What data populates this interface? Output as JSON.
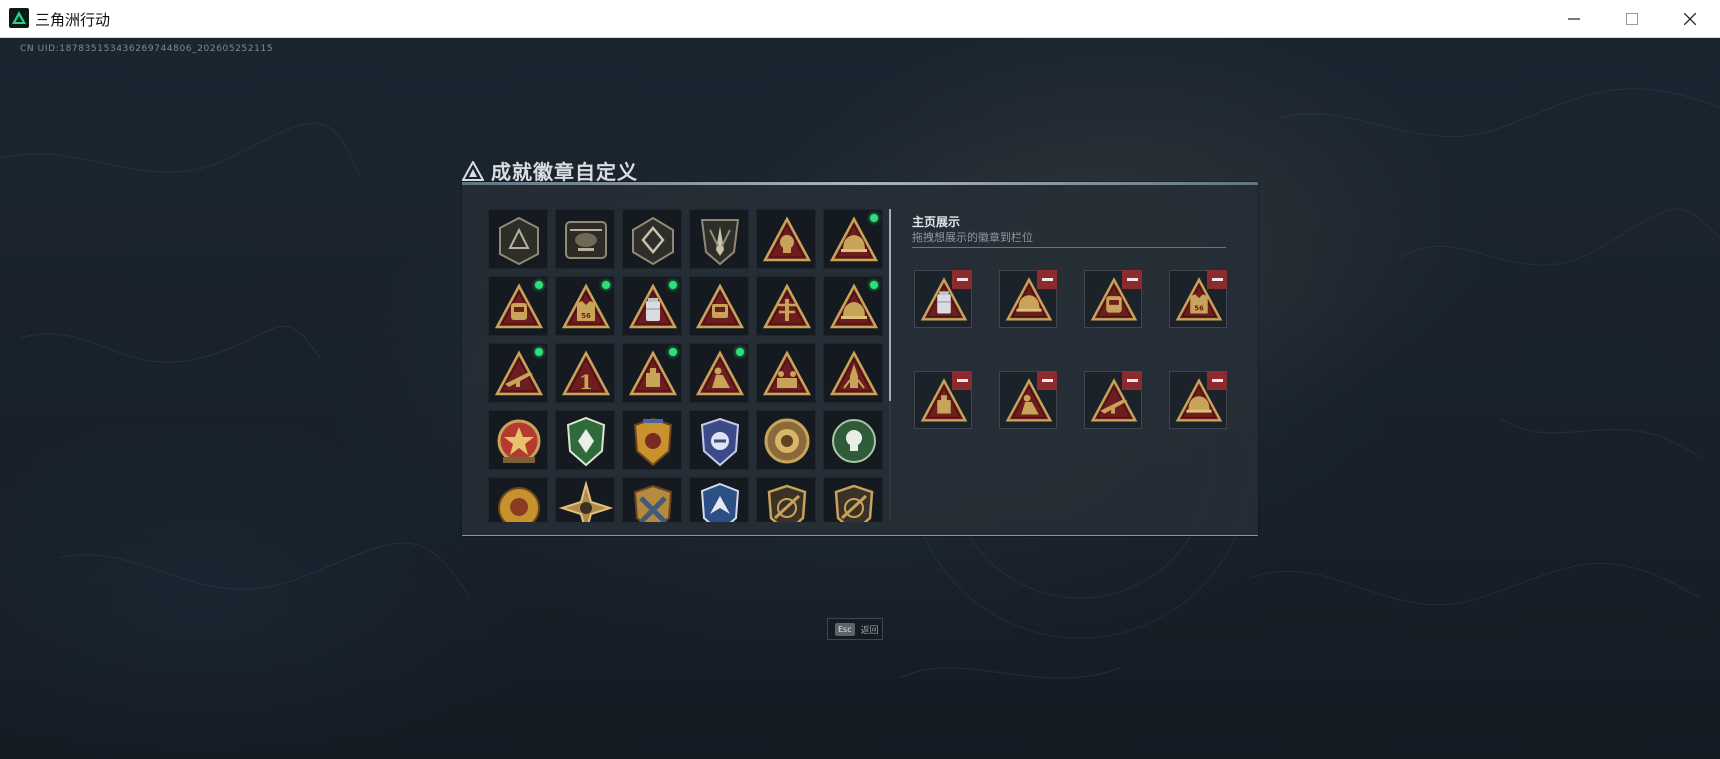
{
  "window": {
    "title": "三角洲行动",
    "icons": {
      "app": "delta-logo-icon",
      "minimize": "minimize-icon",
      "maximize": "maximize-icon",
      "close": "close-icon"
    }
  },
  "overlay": {
    "uid": "CN UID:187835153436269744806_202605252115"
  },
  "panel": {
    "title": "成就徽章自定义",
    "title_icon": "delta-triangle-icon"
  },
  "colors": {
    "gold": "#c8a35a",
    "dark_red": "#6e1d1f",
    "new_dot": "#2ee07a",
    "remove": "#8c2a2e"
  },
  "badge_grid": {
    "rows": [
      [
        {
          "icon": "delta-emblem-badge",
          "new": false
        },
        {
          "icon": "helicopter-badge",
          "new": false
        },
        {
          "icon": "diamond-crest-badge",
          "new": false
        },
        {
          "icon": "blade-crest-badge",
          "new": false
        },
        {
          "icon": "skull-triangle-badge",
          "new": false
        },
        {
          "icon": "helmet-triangle-badge",
          "new": true
        }
      ],
      [
        {
          "icon": "backpack-triangle-badge",
          "new": true
        },
        {
          "icon": "vest-56-triangle-badge",
          "new": true
        },
        {
          "icon": "silver-jar-triangle-badge",
          "new": true
        },
        {
          "icon": "device-triangle-badge",
          "new": false
        },
        {
          "icon": "radio-tower-triangle-badge",
          "new": false
        },
        {
          "icon": "helmet-triangle-badge",
          "new": true
        }
      ],
      [
        {
          "icon": "rifle-triangle-badge",
          "new": true
        },
        {
          "icon": "number-one-triangle-badge",
          "new": false
        },
        {
          "icon": "crate-triangle-badge",
          "new": true
        },
        {
          "icon": "soldier-triangle-badge",
          "new": true
        },
        {
          "icon": "squad-triangle-badge",
          "new": false
        },
        {
          "icon": "rocket-triangle-badge",
          "new": false
        }
      ],
      [
        {
          "icon": "red-star-medal-badge",
          "new": false
        },
        {
          "icon": "green-shield-badge",
          "new": false
        },
        {
          "icon": "gold-shield-badge",
          "new": false
        },
        {
          "icon": "blue-shield-badge",
          "new": false
        },
        {
          "icon": "gold-disc-badge",
          "new": false
        },
        {
          "icon": "green-skull-badge",
          "new": false
        }
      ],
      [
        {
          "icon": "gold-lion-badge",
          "new": false
        },
        {
          "icon": "gold-star-burst-badge",
          "new": false
        },
        {
          "icon": "gold-crossed-badge",
          "new": false
        },
        {
          "icon": "blue-wolf-badge",
          "new": false
        },
        {
          "icon": "gold-slash-shield-badge",
          "new": false
        },
        {
          "icon": "gold-slash-shield-badge",
          "new": false
        }
      ]
    ]
  },
  "showcase": {
    "title": "主页展示",
    "hint": "拖拽想展示的徽章到栏位",
    "slots": [
      {
        "icon": "silver-jar-triangle-badge"
      },
      {
        "icon": "helmet-triangle-badge"
      },
      {
        "icon": "backpack-triangle-badge"
      },
      {
        "icon": "vest-56-triangle-badge"
      },
      {
        "icon": "crate-triangle-badge"
      },
      {
        "icon": "soldier-triangle-badge"
      },
      {
        "icon": "rifle-triangle-badge"
      },
      {
        "icon": "helmet-triangle-badge"
      }
    ]
  },
  "footer": {
    "esc_key": "Esc",
    "esc_label": "返回"
  }
}
